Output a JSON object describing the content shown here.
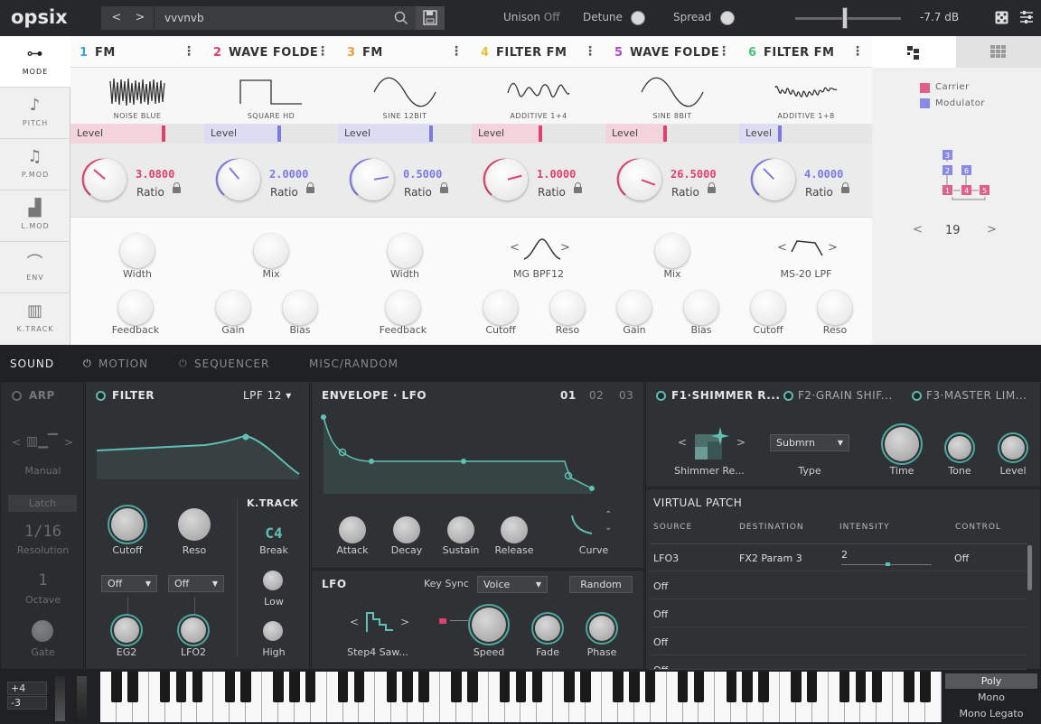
{
  "app": {
    "logo": "opsix",
    "program_name": "vvvnvb"
  },
  "topbar": {
    "unison_label": "Unison",
    "unison_value": "Off",
    "detune_label": "Detune",
    "spread_label": "Spread",
    "master_level": "-7.7 dB",
    "prev": "<",
    "next": ">"
  },
  "modes": [
    {
      "label": "MODE",
      "icon": "mode-icon"
    },
    {
      "label": "PITCH",
      "icon": "note-icon"
    },
    {
      "label": "P.MOD",
      "icon": "pmod-icon"
    },
    {
      "label": "L.MOD",
      "icon": "lmod-icon"
    },
    {
      "label": "ENV",
      "icon": "envelope-icon"
    },
    {
      "label": "K.TRACK",
      "icon": "keyboard-icon"
    }
  ],
  "operators": [
    {
      "num": "1",
      "type": "FM",
      "color": "#3aa3d8",
      "wave": "NOISE BLUE",
      "level": "Level",
      "ratio": "3.0800",
      "ratio_label": "Ratio",
      "ratio_color": "#e0406a",
      "fill": "#f3d4dc",
      "mark": "#e0406a",
      "filter": "",
      "k1": "Width",
      "k2": "Feedback",
      "k3": ""
    },
    {
      "num": "2",
      "type": "WAVE FOLDE",
      "color": "#e0406a",
      "wave": "SQUARE HD",
      "level": "Level",
      "ratio": "2.0000",
      "ratio_label": "Ratio",
      "ratio_color": "#7a7ae6",
      "fill": "#dcdcf2",
      "mark": "#7a7ae6",
      "filter": "",
      "k1": "Mix",
      "k2": "Gain",
      "k3": "Bias"
    },
    {
      "num": "3",
      "type": "FM",
      "color": "#e9a23b",
      "wave": "SINE 12BIT",
      "level": "Level",
      "ratio": "0.5000",
      "ratio_label": "Ratio",
      "ratio_color": "#7a7ae6",
      "fill": "#dcdcf2",
      "mark": "#7a7ae6",
      "filter": "",
      "k1": "Width",
      "k2": "Feedback",
      "k3": ""
    },
    {
      "num": "4",
      "type": "FILTER FM",
      "color": "#e0c13b",
      "wave": "ADDITIVE 1+4",
      "level": "Level",
      "ratio": "1.0000",
      "ratio_label": "Ratio",
      "ratio_color": "#e0406a",
      "fill": "#f3d4dc",
      "mark": "#e0406a",
      "filter": "MG BPF12",
      "k1": "",
      "k2": "Cutoff",
      "k3": "Reso"
    },
    {
      "num": "5",
      "type": "WAVE FOLDE",
      "color": "#b24ac8",
      "wave": "SINE 8BIT",
      "level": "Level",
      "ratio": "26.5000",
      "ratio_label": "Ratio",
      "ratio_color": "#e0406a",
      "fill": "#f3d4dc",
      "mark": "#e0406a",
      "filter": "",
      "k1": "Mix",
      "k2": "Gain",
      "k3": "Bias"
    },
    {
      "num": "6",
      "type": "FILTER FM",
      "color": "#4ac07a",
      "wave": "ADDITIVE 1+8",
      "level": "Level",
      "ratio": "4.0000",
      "ratio_label": "Ratio",
      "ratio_color": "#7a7ae6",
      "fill": "#dcdcf2",
      "mark": "#7a7ae6",
      "filter": "MS-20 LPF",
      "k1": "",
      "k2": "Cutoff",
      "k3": "Reso"
    }
  ],
  "algorithm": {
    "legend_carrier": "Carrier",
    "legend_modulator": "Modulator",
    "number": "19",
    "carrier_color": "#e0608a",
    "modulator_color": "#8a8ae6",
    "boxes": [
      "3",
      "2",
      "6",
      "1",
      "4",
      "5"
    ]
  },
  "tabs": [
    "SOUND",
    "MOTION",
    "SEQUENCER",
    "MISC/RANDOM"
  ],
  "arp": {
    "title": "ARP",
    "mode": "Manual",
    "latch": "Latch",
    "resolution_val": "1/16",
    "resolution": "Resolution",
    "octave_val": "1",
    "octave": "Octave",
    "gate": "Gate"
  },
  "filter": {
    "title": "FILTER",
    "type": "LPF 12",
    "cutoff": "Cutoff",
    "reso": "Reso",
    "ktrack": "K.TRACK",
    "break_val": "C4",
    "break": "Break",
    "low": "Low",
    "high": "High",
    "eg_sel": "Off",
    "lfo_sel": "Off",
    "eg2": "EG2",
    "lfo2": "LFO2"
  },
  "envelope": {
    "title": "ENVELOPE · LFO",
    "n1": "01",
    "n2": "02",
    "n3": "03",
    "attack": "Attack",
    "decay": "Decay",
    "sustain": "Sustain",
    "release": "Release",
    "curve": "Curve"
  },
  "lfo": {
    "title": "LFO",
    "keysync_label": "Key Sync",
    "keysync": "Voice",
    "random": "Random",
    "wave": "Step4 Saw...",
    "speed": "Speed",
    "fade": "Fade",
    "phase": "Phase"
  },
  "effects": {
    "f1": "F1·SHIMMER R...",
    "f2": "F2·GRAIN SHIF...",
    "f3": "F3·MASTER LIM...",
    "preset": "Shimmer Re...",
    "type_sel": "Submrn",
    "type": "Type",
    "time": "Time",
    "tone": "Tone",
    "level": "Level"
  },
  "vpatch": {
    "title": "VIRTUAL PATCH",
    "cols": [
      "SOURCE",
      "DESTINATION",
      "INTENSITY",
      "CONTROL"
    ],
    "rows": [
      {
        "src": "LFO3",
        "dst": "FX2 Param 3",
        "int": "2",
        "ctl": "Off"
      },
      {
        "src": "Off",
        "dst": "",
        "int": "",
        "ctl": ""
      },
      {
        "src": "Off",
        "dst": "",
        "int": "",
        "ctl": ""
      },
      {
        "src": "Off",
        "dst": "",
        "int": "",
        "ctl": ""
      },
      {
        "src": "Off",
        "dst": "",
        "int": "",
        "ctl": ""
      }
    ]
  },
  "keyboard": {
    "oct_up": "+4",
    "oct_down": "-3",
    "modes": [
      "Poly",
      "Mono",
      "Mono Legato"
    ]
  }
}
